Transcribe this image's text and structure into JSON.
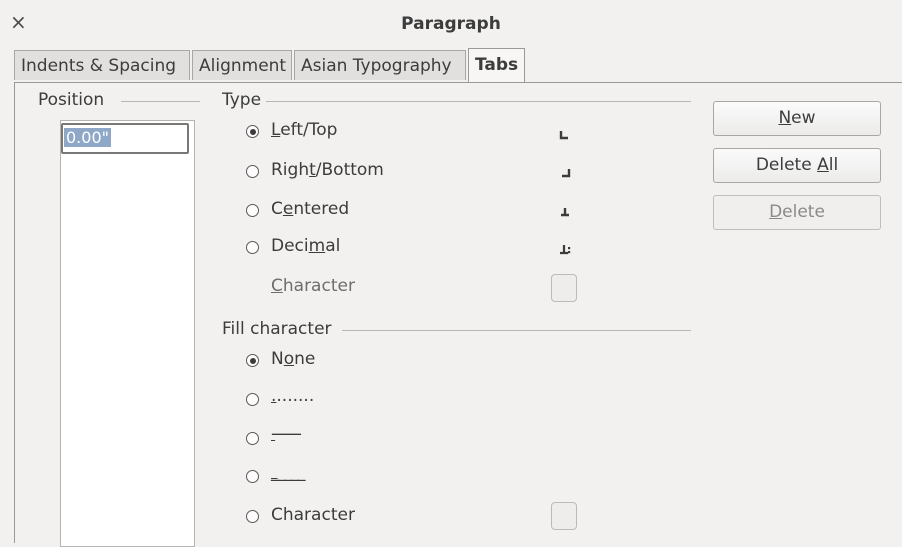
{
  "window": {
    "title": "Paragraph",
    "close_glyph": "×"
  },
  "tabs": [
    {
      "label": "Indents & Spacing",
      "active": false
    },
    {
      "label": "Alignment",
      "active": false
    },
    {
      "label": "Asian Typography",
      "active": false
    },
    {
      "label": "Tabs",
      "active": true
    }
  ],
  "position": {
    "label": "Position",
    "value": "0.00\""
  },
  "type_section": {
    "label": "Type",
    "options": [
      {
        "pre": "",
        "key": "L",
        "post": "eft/Top",
        "checked": true,
        "icon": "left-tab-icon"
      },
      {
        "pre": "Righ",
        "key": "t",
        "post": "/Bottom",
        "checked": false,
        "icon": "right-tab-icon"
      },
      {
        "pre": "C",
        "key": "e",
        "post": "ntered",
        "checked": false,
        "icon": "centered-tab-icon"
      },
      {
        "pre": "Deci",
        "key": "m",
        "post": "al",
        "checked": false,
        "icon": "decimal-tab-icon"
      }
    ],
    "character": {
      "pre": "",
      "key": "C",
      "post": "haracter",
      "disabled": true
    }
  },
  "fill_section": {
    "label": "Fill character",
    "options": [
      {
        "pre": "N",
        "key": "o",
        "post": "ne",
        "checked": true
      },
      {
        "pre": "",
        "key": ".",
        "post": ".......",
        "checked": false
      },
      {
        "pre": "",
        "key": "-",
        "post": "------",
        "checked": false
      },
      {
        "pre": "",
        "key": "_",
        "post": "____",
        "checked": false
      }
    ],
    "character": {
      "label": "Character",
      "checked": false
    }
  },
  "buttons": {
    "new": {
      "pre": "",
      "key": "N",
      "post": "ew"
    },
    "delete_all": {
      "pre": "Delete ",
      "key": "A",
      "post": "ll"
    },
    "delete": {
      "pre": "",
      "key": "D",
      "post": "elete",
      "disabled": true
    }
  },
  "colors": {
    "background": "#f2f1f0",
    "selection": "#8fa8c8"
  }
}
